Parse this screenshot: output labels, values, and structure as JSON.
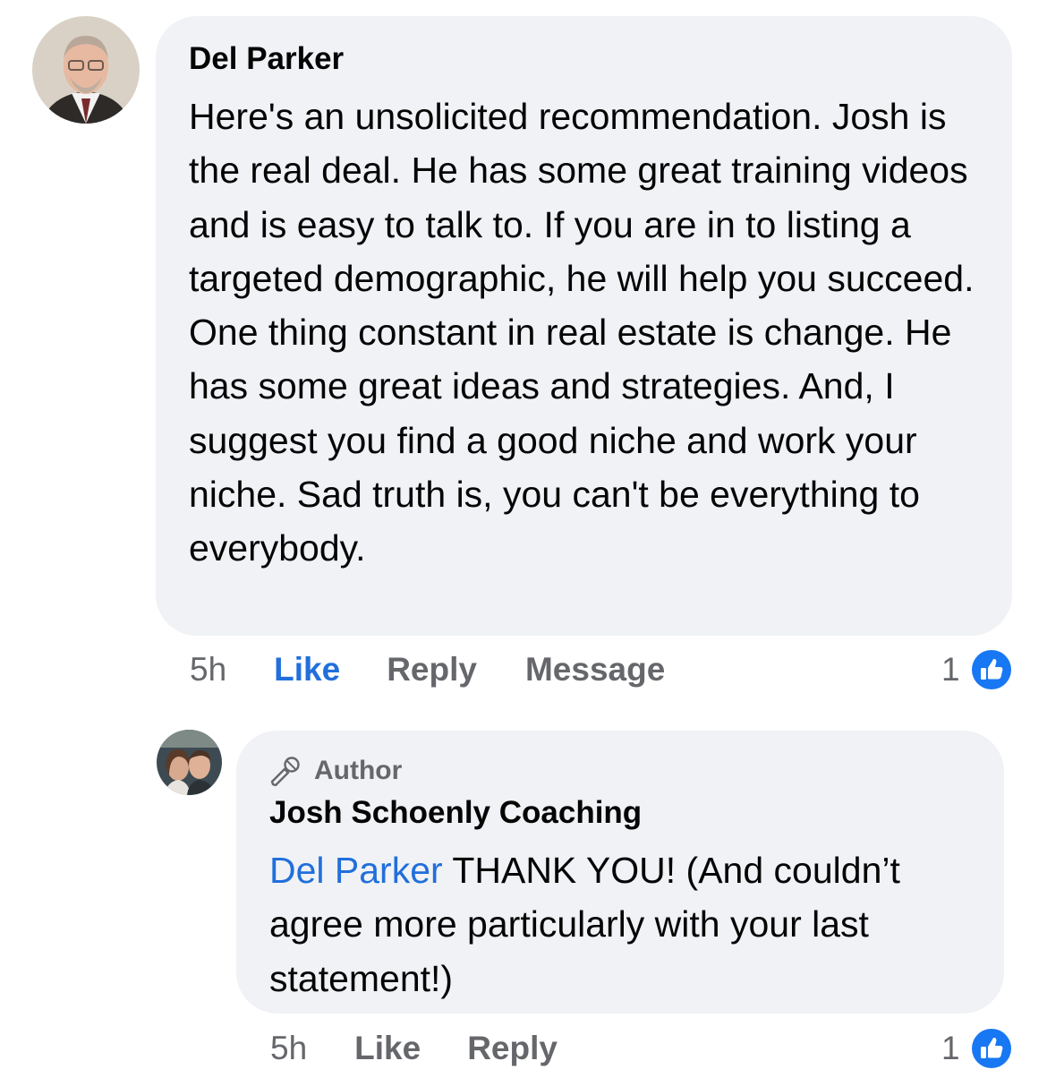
{
  "comments": [
    {
      "author": "Del Parker",
      "text": "Here's an unsolicited recommendation. Josh is the real deal. He has some great training videos and is easy to talk to. If you are in to listing a targeted demographic, he will help you succeed.  One thing constant in real estate is change. He has some great ideas and strategies.  And, I suggest you find a good niche and work your niche. Sad truth is, you can't be everything to everybody.",
      "time": "5h",
      "like_label": "Like",
      "reply_label": "Reply",
      "message_label": "Message",
      "reaction_count": "1",
      "reaction_icon": "thumbs-up-icon"
    }
  ],
  "replies": [
    {
      "badge": "Author",
      "badge_icon": "microphone-icon",
      "author": "Josh Schoenly Coaching",
      "mention": "Del Parker",
      "text": " THANK YOU! (And couldn’t agree more particularly with your last statement!)",
      "time": "5h",
      "like_label": "Like",
      "reply_label": "Reply",
      "reaction_count": "1",
      "reaction_icon": "thumbs-up-icon"
    }
  ],
  "colors": {
    "bubble_bg": "#f0f2f5",
    "link_blue": "#216fdb",
    "secondary_text": "#65676b",
    "like_badge": "#1877f2"
  }
}
